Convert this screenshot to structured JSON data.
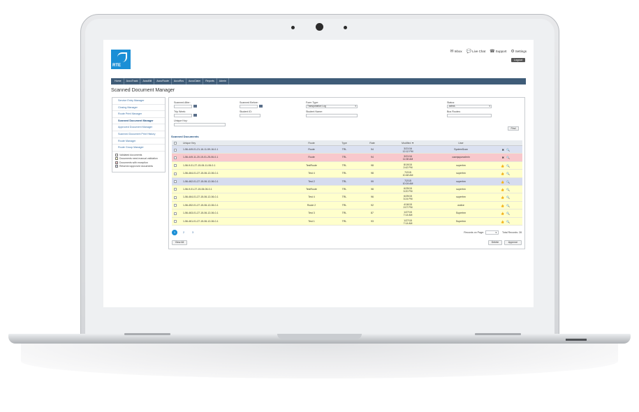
{
  "header": {
    "logo_text": "RTE",
    "links": [
      {
        "icon": "mail-icon",
        "label": "Inbox"
      },
      {
        "icon": "chat-icon",
        "label": "Live Chat"
      },
      {
        "icon": "phone-icon",
        "label": "Support"
      },
      {
        "icon": "gear-icon",
        "label": "Settings"
      }
    ],
    "logout_label": "Logout"
  },
  "nav": [
    "Home",
    "AccuTrack",
    "AccuBill",
    "AccuRoute",
    "AccuRcs",
    "AccuClaim",
    "Reports",
    "Admin"
  ],
  "page_title": "Scanned Document Manager",
  "left_nav": {
    "items": [
      "Service Entry Manager",
      "Closing Manager",
      "Route Print Manager",
      "Scanned Document Manager",
      "Approved Document Manager",
      "Scanned Document Print History",
      "Route Manager",
      "Route Group Manager"
    ],
    "active_index": 3,
    "legend": [
      {
        "label": "Validated documents",
        "color": "#ffffff"
      },
      {
        "label": "Documents need manual validation",
        "color": "#ffffcc"
      },
      {
        "label": "Documents with exception",
        "color": "#f8c8cc"
      },
      {
        "label": "Returned approved documents",
        "color": "#d6dcef"
      }
    ]
  },
  "filters": {
    "scanned_after": "Scanned After:",
    "scanned_before": "Scanned Before:",
    "form_type": "Form Type:",
    "form_type_value": "Transportation Log",
    "status": "Status:",
    "status_value": "-select-",
    "trip_week": "Trip Week:",
    "student_id": "Student ID:",
    "student_name": "Student Name:",
    "bus_routes": "Bus Routes:",
    "unique_key": "Unique Key:",
    "find_label": "Find"
  },
  "grid": {
    "section_title": "Scanned Documents",
    "columns": [
      "Unique Key",
      "Route",
      "Type",
      "Rate",
      "Modified ▼",
      "User"
    ],
    "rows": [
      {
        "key": "1-56-449-01-21-16-11-59-16-0-1",
        "route": "Route",
        "type": "TRL",
        "rate": "94",
        "date": "3/21/16",
        "time": "12:12 PM",
        "user": "SystemScan",
        "color": "#dbe1f1",
        "acts": [
          "✖",
          "🔍"
        ]
      },
      {
        "key": "1-56-449-11-20-15-01-25-06-0-1",
        "route": "Route",
        "type": "TRL",
        "rate": "94",
        "date": "3/21/16",
        "time": "11:08 AM",
        "user": "cawqsqueadmin",
        "color": "#f8c8cc",
        "acts": [
          "✖",
          "🔍"
        ]
      },
      {
        "key": "1-56-9-01-27-15-06-11-06-0-1",
        "route": "TestRoute",
        "type": "TRL",
        "rate": "98",
        "date": "8/19/15",
        "time": "2:42 PM",
        "user": "superhm",
        "color": "#ffffcc",
        "acts": [
          "👍",
          "🔍"
        ]
      },
      {
        "key": "1-56-464-01-27-15-06-12-06-0-1",
        "route": "Test 4",
        "type": "TRL",
        "rate": "98",
        "date": "7/2/15",
        "time": "10:48 AM",
        "user": "superhm",
        "color": "#ffffcc",
        "acts": [
          "👍",
          "🔍"
        ]
      },
      {
        "key": "1-56-462-01-27-15-06-12-06-0-1",
        "route": "Test 2",
        "type": "TRL",
        "rate": "99",
        "date": "7/2/15",
        "time": "10:24 AM",
        "user": "superhm",
        "color": "#d6dcef",
        "acts": [
          "👍",
          "🔍"
        ]
      },
      {
        "key": "1-56-9-01-27-15-06-06-0-1",
        "route": "TestRoute",
        "type": "TRL",
        "rate": "98",
        "date": "6/25/15",
        "time": "3:20 PM",
        "user": "superhm",
        "color": "#ffffcc",
        "acts": [
          "👍",
          "🔍"
        ]
      },
      {
        "key": "1-56-464-01-27-15-06-12-06-0-1",
        "route": "Test 4",
        "type": "TRL",
        "rate": "96",
        "date": "6/25/15",
        "time": "3:24 PM",
        "user": "superhm",
        "color": "#ffffcc",
        "acts": [
          "👍",
          "🔍"
        ]
      },
      {
        "key": "1-56-452-01-27-15-06-12-06-0-1",
        "route": "Route 2",
        "type": "TRL",
        "rate": "92",
        "date": "4/16/15",
        "time": "2:07 PM",
        "user": "wolive",
        "color": "#ffffcc",
        "acts": [
          "👍",
          "🔍"
        ]
      },
      {
        "key": "1-56-463-01-27-15-06-12-06-0-1",
        "route": "Test 3",
        "type": "TRL",
        "rate": "87",
        "date": "1/27/15",
        "time": "7:14 AM",
        "user": "Superhm",
        "color": "#ffffcc",
        "acts": [
          "👍",
          "🔍"
        ]
      },
      {
        "key": "1-56-461-01-27-15-06-12-06-0-1",
        "route": "Test 1",
        "type": "TRL",
        "rate": "93",
        "date": "1/27/15",
        "time": "7:14 AM",
        "user": "Superhm",
        "color": "#ffffcc",
        "acts": [
          "👍",
          "🔍"
        ]
      }
    ]
  },
  "pager": {
    "pages": [
      "1",
      "2",
      "3"
    ],
    "current": 0,
    "records_label": "Records on Page:",
    "total_label": "Total Records: 28"
  },
  "buttons": {
    "view_all": "View All",
    "delete": "Delete",
    "approve": "Approve"
  }
}
